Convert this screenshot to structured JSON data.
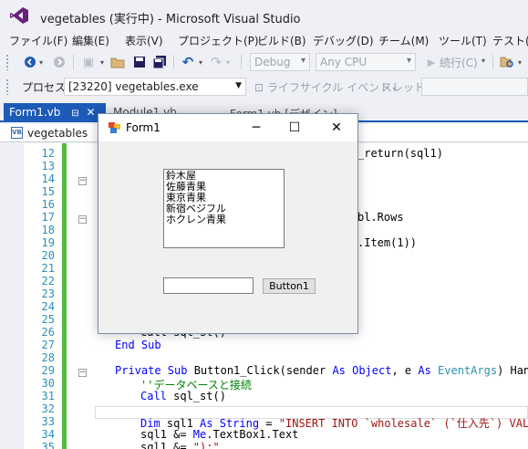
{
  "window": {
    "title": "vegetables (実行中) - Microsoft Visual Studio"
  },
  "menu": [
    "ファイル(F)",
    "編集(E)",
    "表示(V)",
    "プロジェクト(P)",
    "ビルド(B)",
    "デバッグ(D)",
    "チーム(M)",
    "ツール(T)",
    "テスト(S)"
  ],
  "toolbar": {
    "configuration": "Debug",
    "platform": "Any CPU",
    "continue_label": "続行(C)"
  },
  "process_bar": {
    "label": "プロセス:",
    "process": "[23220] vegetables.exe",
    "lifecycle": "ライフサイクル イベント",
    "thread": "スレッド:"
  },
  "tabs": [
    {
      "label": "Form1.vb",
      "active": true
    },
    {
      "label": "Module1.vb",
      "active": false
    },
    {
      "label": "Form1.vb [デザイン]",
      "active": false
    }
  ],
  "nav": {
    "class_name": "vegetables"
  },
  "editor": {
    "line_numbers": [
      "12",
      "13",
      "14",
      "15",
      "16",
      "17",
      "18",
      "19",
      "20",
      "21",
      "22",
      "23",
      "24",
      "25",
      "26",
      "27",
      "28",
      "29",
      "30",
      "31",
      "32",
      "33",
      "34",
      "35"
    ],
    "visible_fragments": {
      "l12": "_return(sql1)",
      "l17": "bl.Rows",
      "l19": ".Item(1))",
      "l26": "Call sql_st()"
    },
    "end_sub": "End Sub",
    "l29": {
      "kw1": "Private Sub",
      "rest1": " Button1_Click(sender ",
      "kw2": "As Object",
      "rest2": ", e ",
      "kw3": "As",
      "type": " EventArgs",
      "rest3": ") Handl"
    },
    "l30_comment": "''データベースと接続",
    "l31": {
      "kw": "Call",
      "rest": " sql_st()"
    },
    "l33": {
      "kw1": "Dim",
      "rest1": " sql1 ",
      "kw2": "As String",
      "rest2": " = ",
      "str": "\"INSERT INTO `wholesale` (`仕入先`) VALL"
    },
    "l34": {
      "rest1": "sql1 &= ",
      "kw": "Me",
      "rest2": ".TextBox1.Text"
    },
    "l35": {
      "rest1": "sql1 &= ",
      "str": "\");\""
    }
  },
  "form1": {
    "title": "Form1",
    "listbox_items": [
      "鈴木屋",
      "佐藤青果",
      "東京青果",
      "新宿ベジフル",
      "ホクレン青果"
    ],
    "textbox_value": "",
    "button_label": "Button1"
  },
  "colors": {
    "accent": "#1c5bb8",
    "keyword": "#0000ff",
    "comment": "#008000",
    "string": "#a31515",
    "type": "#2b91af",
    "change_bar": "#57b847"
  }
}
